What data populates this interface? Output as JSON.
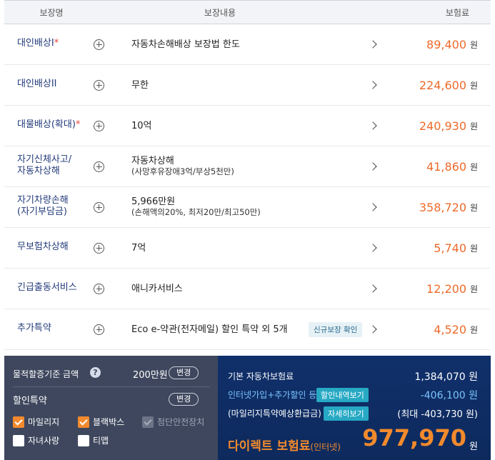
{
  "table": {
    "headers": {
      "name": "보장명",
      "content": "보장내용",
      "premium": "보험료"
    },
    "rows": [
      {
        "name": "대인배상I",
        "required": "*",
        "content": "자동차손해배상 보장법 한도",
        "sub": "",
        "badge": "",
        "price": "89,400",
        "unit": "원"
      },
      {
        "name": "대인배상II",
        "required": "",
        "content": "무한",
        "sub": "",
        "badge": "",
        "price": "224,600",
        "unit": "원"
      },
      {
        "name": "대물배상(확대)",
        "required": "*",
        "content": "10억",
        "sub": "",
        "badge": "",
        "price": "240,930",
        "unit": "원"
      },
      {
        "name": "자기신체사고/\n자동차상해",
        "required": "",
        "content": "자동차상해",
        "sub": "(사망후유장애3억/부상5천만)",
        "badge": "",
        "price": "41,860",
        "unit": "원"
      },
      {
        "name": "자기차량손해\n(자기부담금)",
        "required": "",
        "content": "5,966만원",
        "sub": "(손해액의20%, 최저20만/최고50만)",
        "badge": "",
        "price": "358,720",
        "unit": "원"
      },
      {
        "name": "무보험차상해",
        "required": "",
        "content": "7억",
        "sub": "",
        "badge": "",
        "price": "5,740",
        "unit": "원"
      },
      {
        "name": "긴급출동서비스",
        "required": "",
        "content": "애니카서비스",
        "sub": "",
        "badge": "",
        "price": "12,200",
        "unit": "원"
      },
      {
        "name": "추가특약",
        "required": "",
        "content": "Eco e-약관(전자메일) 할인 특약 외 5개",
        "sub": "",
        "badge": "신규보장 확인",
        "price": "4,520",
        "unit": "원"
      }
    ]
  },
  "left_panel": {
    "property_label": "물적할증기준 금액",
    "property_amount": "200만원",
    "change_label": "변경",
    "discount_title": "할인특약",
    "checkboxes": [
      {
        "label": "마일리지",
        "state": "on"
      },
      {
        "label": "블랙박스",
        "state": "on"
      },
      {
        "label": "첨단안전장치",
        "state": "disabled"
      },
      {
        "label": "자녀사랑",
        "state": "off"
      },
      {
        "label": "티맵",
        "state": "off"
      }
    ]
  },
  "right_panel": {
    "base_label": "기본 자동차보험료",
    "base_value": "1,384,070 원",
    "discount_label": "인터넷가입+추가할인 등",
    "discount_tag": "할인내역보기",
    "discount_value": "-406,100 원",
    "mileage_label": "(마일리지특약예상환급금)",
    "mileage_tag": "자세히보기",
    "mileage_value": "(최대 -403,730 원)",
    "final_label": "다이렉트 보험료",
    "final_label_suffix": "(인터넷)",
    "final_amount": "977,970",
    "final_unit": "원"
  },
  "colors": {
    "accent_orange": "#ee6a2a",
    "navy": "#10306b",
    "slate": "#3e475d",
    "tag_blue": "#27a9c4"
  }
}
